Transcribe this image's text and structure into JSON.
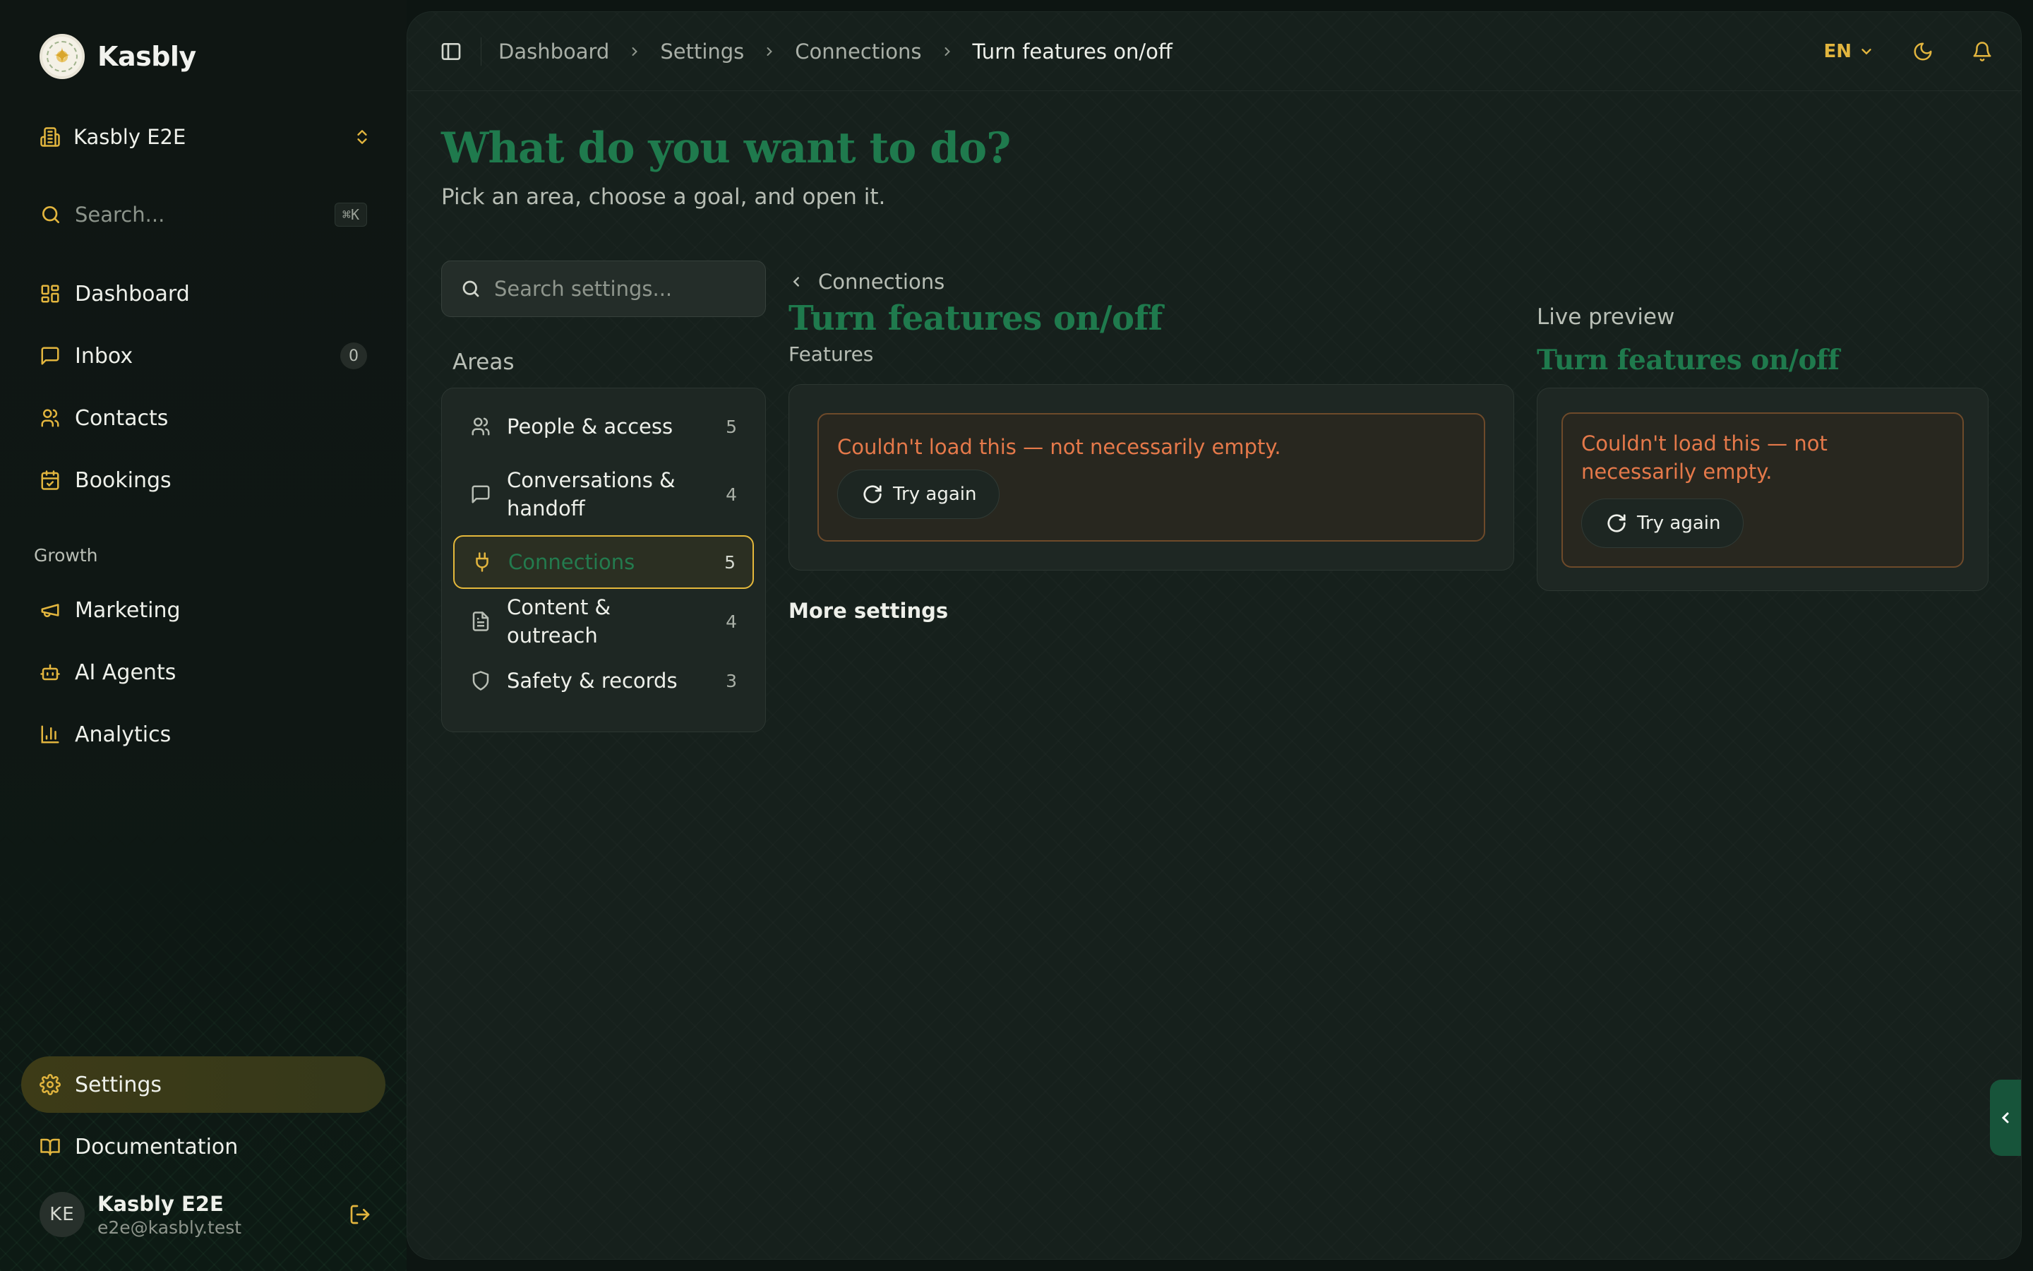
{
  "app": {
    "name": "Kasbly"
  },
  "workspace": {
    "name": "Kasbly E2E"
  },
  "sidebar": {
    "search_placeholder": "Search...",
    "search_shortcut": "⌘K",
    "items": [
      {
        "label": "Dashboard",
        "icon": "dashboard-icon"
      },
      {
        "label": "Inbox",
        "icon": "inbox-icon",
        "count": "0"
      },
      {
        "label": "Contacts",
        "icon": "contacts-icon"
      },
      {
        "label": "Bookings",
        "icon": "calendar-icon"
      }
    ],
    "growth_label": "Growth",
    "growth_items": [
      {
        "label": "Marketing",
        "icon": "megaphone-icon"
      },
      {
        "label": "AI Agents",
        "icon": "bot-icon"
      },
      {
        "label": "Analytics",
        "icon": "chart-icon"
      }
    ],
    "bottom_items": [
      {
        "label": "Settings",
        "icon": "gear-icon",
        "active": true
      },
      {
        "label": "Documentation",
        "icon": "book-icon"
      }
    ],
    "user": {
      "initials": "KE",
      "name": "Kasbly E2E",
      "email": "e2e@kasbly.test"
    }
  },
  "header": {
    "breadcrumbs": [
      "Dashboard",
      "Settings",
      "Connections",
      "Turn features on/off"
    ],
    "language": "EN"
  },
  "page": {
    "title": "What do you want to do?",
    "subtitle": "Pick an area, choose a goal, and open it.",
    "settings_search_placeholder": "Search settings...",
    "areas_label": "Areas",
    "areas": [
      {
        "label": "People & access",
        "count": "5",
        "icon": "people-icon"
      },
      {
        "label": "Conversations & handoff",
        "count": "4",
        "icon": "chat-icon"
      },
      {
        "label": "Connections",
        "count": "5",
        "icon": "plug-icon",
        "active": true
      },
      {
        "label": "Content & outreach",
        "count": "4",
        "icon": "document-icon"
      },
      {
        "label": "Safety & records",
        "count": "3",
        "icon": "shield-icon"
      }
    ]
  },
  "detail": {
    "back_label": "Connections",
    "title": "Turn features on/off",
    "subtitle": "Features",
    "error_text": "Couldn't load this — not necessarily empty.",
    "retry_label": "Try again",
    "more_label": "More settings"
  },
  "preview": {
    "label": "Live preview",
    "title": "Turn features on/off",
    "error_text": "Couldn't load this — not necessarily empty.",
    "retry_label": "Try again"
  },
  "colors": {
    "accent_gold": "#e4b83b",
    "brand_green": "#1f7a4d",
    "error_orange": "#e5794a"
  }
}
